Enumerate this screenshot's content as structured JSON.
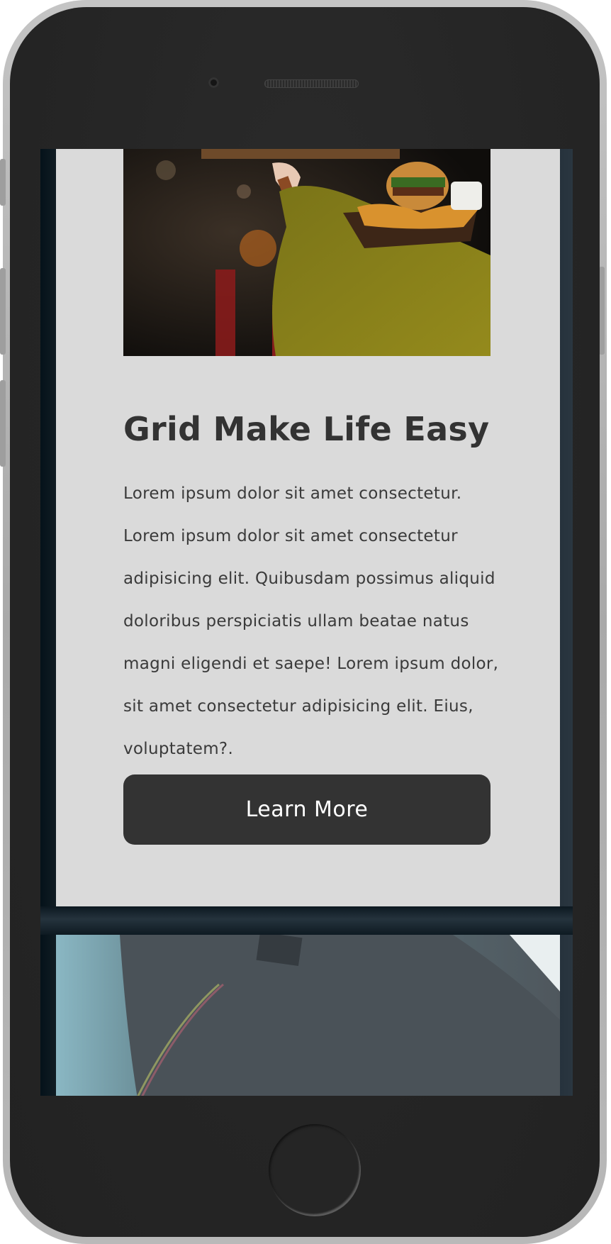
{
  "card": {
    "image_alt": "Person holding a plate with a burger and potato wedges",
    "title": "Grid Make Life Easy",
    "body": "Lorem ipsum dolor sit amet consectetur. Lorem ipsum dolor sit amet consectetur adipisicing elit. Quibusdam possimus aliquid doloribus perspiciatis ullam beatae natus magni eligendi et saepe! Lorem ipsum dolor, sit amet consectetur adipisicing elit. Eius, voluptatem?.",
    "button_label": "Learn More"
  },
  "colors": {
    "card_background": "#dadada",
    "button_background": "#333333",
    "button_text": "#ffffff",
    "title_text": "#333333",
    "phone_body": "#252525"
  },
  "icons": {
    "camera": "camera-icon",
    "speaker": "speaker-grille-icon",
    "home": "home-button-icon"
  }
}
